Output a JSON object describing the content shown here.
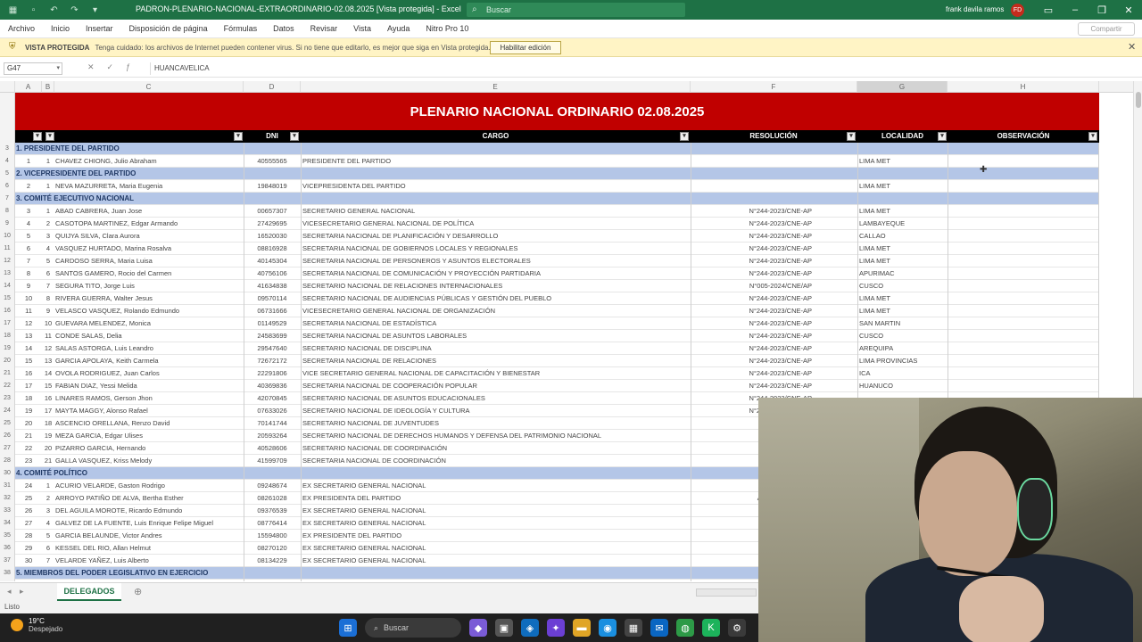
{
  "window": {
    "title": "PADRON-PLENARIO-NACIONAL-EXTRAORDINARIO-02.08.2025 [Vista protegida] - Excel",
    "search_placeholder": "Buscar",
    "user_name": "frank davila ramos",
    "user_initials": "FD"
  },
  "menu": [
    "Archivo",
    "Inicio",
    "Insertar",
    "Disposición de página",
    "Fórmulas",
    "Datos",
    "Revisar",
    "Vista",
    "Ayuda",
    "Nitro Pro 10"
  ],
  "share_label": "Compartir",
  "protected_view": {
    "label": "VISTA PROTEGIDA",
    "message": "Tenga cuidado: los archivos de Internet pueden contener virus. Si no tiene que editarlo, es mejor que siga en Vista protegida.",
    "button": "Habilitar edición"
  },
  "formula_bar": {
    "cell_ref": "G47",
    "formula": "HUANCAVELICA"
  },
  "columns": [
    "A",
    "B",
    "C",
    "D",
    "E",
    "F",
    "G",
    "H"
  ],
  "sheet": {
    "banner_title": "PLENARIO NACIONAL ORDINARIO 02.08.2025",
    "headers": {
      "dni": "DNI",
      "cargo": "CARGO",
      "resolucion": "RESOLUCIÓN",
      "localidad": "LOCALIDAD",
      "observacion": "OBSERVACIÓN"
    },
    "rows": [
      {
        "n": "3",
        "section": "1. PRESIDENTE DEL PARTIDO"
      },
      {
        "n": "4",
        "a": "1",
        "b": "1",
        "name": "CHAVEZ CHIONG, Julio Abraham",
        "dni": "40555565",
        "cargo": "PRESIDENTE DEL PARTIDO",
        "res": "",
        "loc": "LIMA MET"
      },
      {
        "n": "5",
        "section": "2. VICEPRESIDENTE DEL PARTIDO"
      },
      {
        "n": "6",
        "a": "2",
        "b": "1",
        "name": "NEVA MAZURRETA, Maria Eugenia",
        "dni": "19848019",
        "cargo": "VICEPRESIDENTA DEL PARTIDO",
        "res": "",
        "loc": "LIMA MET"
      },
      {
        "n": "7",
        "section": "3. COMITÉ EJECUTIVO NACIONAL"
      },
      {
        "n": "8",
        "a": "3",
        "b": "1",
        "name": "ABAD CABRERA, Juan Jose",
        "dni": "00657307",
        "cargo": "SECRETARIO GENERAL NACIONAL",
        "res": "N°244-2023/CNE-AP",
        "loc": "LIMA MET"
      },
      {
        "n": "9",
        "a": "4",
        "b": "2",
        "name": "CASOTOPA MARTINEZ, Edgar Armando",
        "dni": "27429695",
        "cargo": "VICESECRETARIO GENERAL NACIONAL DE POLÍTICA",
        "res": "N°244-2023/CNE-AP",
        "loc": "LAMBAYEQUE"
      },
      {
        "n": "10",
        "a": "5",
        "b": "3",
        "name": "QUIJYA SILVA, Clara Aurora",
        "dni": "16520030",
        "cargo": "SECRETARIA NACIONAL DE PLANIFICACIÓN Y DESARROLLO",
        "res": "N°244-2023/CNE-AP",
        "loc": "CALLAO"
      },
      {
        "n": "11",
        "a": "6",
        "b": "4",
        "name": "VASQUEZ HURTADO, Marina Rosalva",
        "dni": "08816928",
        "cargo": "SECRETARIA NACIONAL DE GOBIERNOS LOCALES Y REGIONALES",
        "res": "N°244-2023/CNE-AP",
        "loc": "LIMA MET"
      },
      {
        "n": "12",
        "a": "7",
        "b": "5",
        "name": "CARDOSO SERRA, Maria Luisa",
        "dni": "40145304",
        "cargo": "SECRETARIA NACIONAL DE PERSONEROS Y ASUNTOS ELECTORALES",
        "res": "N°244-2023/CNE-AP",
        "loc": "LIMA MET"
      },
      {
        "n": "13",
        "a": "8",
        "b": "6",
        "name": "SANTOS GAMERO, Rocio del Carmen",
        "dni": "40756106",
        "cargo": "SECRETARIA NACIONAL DE COMUNICACIÓN Y PROYECCIÓN PARTIDARIA",
        "res": "N°244-2023/CNE-AP",
        "loc": "APURIMAC"
      },
      {
        "n": "14",
        "a": "9",
        "b": "7",
        "name": "SEGURA TITO, Jorge Luis",
        "dni": "41634838",
        "cargo": "SECRETARIO NACIONAL DE RELACIONES INTERNACIONALES",
        "res": "N°005-2024/CNE/AP",
        "loc": "CUSCO"
      },
      {
        "n": "15",
        "a": "10",
        "b": "8",
        "name": "RIVERA GUERRA, Walter Jesus",
        "dni": "09570114",
        "cargo": "SECRETARIO NACIONAL DE AUDIENCIAS PÚBLICAS Y GESTIÓN DEL PUEBLO",
        "res": "N°244-2023/CNE-AP",
        "loc": "LIMA MET"
      },
      {
        "n": "16",
        "a": "11",
        "b": "9",
        "name": "VELASCO VASQUEZ, Rolando Edmundo",
        "dni": "06731666",
        "cargo": "VICESECRETARIO GENERAL NACIONAL DE ORGANIZACIÓN",
        "res": "N°244-2023/CNE-AP",
        "loc": "LIMA MET"
      },
      {
        "n": "17",
        "a": "12",
        "b": "10",
        "name": "GUEVARA MELENDEZ, Monica",
        "dni": "01149529",
        "cargo": "SECRETARIA NACIONAL DE ESTADÍSTICA",
        "res": "N°244-2023/CNE-AP",
        "loc": "SAN MARTIN"
      },
      {
        "n": "18",
        "a": "13",
        "b": "11",
        "name": "CONDE SALAS, Delia",
        "dni": "24583699",
        "cargo": "SECRETARIA NACIONAL DE ASUNTOS LABORALES",
        "res": "N°244-2023/CNE-AP",
        "loc": "CUSCO"
      },
      {
        "n": "19",
        "a": "14",
        "b": "12",
        "name": "SALAS ASTORGA, Luis Leandro",
        "dni": "29547640",
        "cargo": "SECRETARIO NACIONAL DE DISCIPLINA",
        "res": "N°244-2023/CNE-AP",
        "loc": "AREQUIPA"
      },
      {
        "n": "20",
        "a": "15",
        "b": "13",
        "name": "GARCIA APOLAYA, Keith Carmela",
        "dni": "72672172",
        "cargo": "SECRETARIA NACIONAL DE RELACIONES",
        "res": "N°244-2023/CNE-AP",
        "loc": "LIMA PROVINCIAS"
      },
      {
        "n": "21",
        "a": "16",
        "b": "14",
        "name": "OVOLA RODRIGUEZ, Juan Carlos",
        "dni": "22291806",
        "cargo": "VICE SECRETARIO GENERAL NACIONAL DE CAPACITACIÓN Y BIENESTAR",
        "res": "N°244-2023/CNE-AP",
        "loc": "ICA"
      },
      {
        "n": "22",
        "a": "17",
        "b": "15",
        "name": "FABIAN DIAZ, Yessi Melida",
        "dni": "40369836",
        "cargo": "SECRETARIA NACIONAL DE COOPERACIÓN POPULAR",
        "res": "N°244-2023/CNE-AP",
        "loc": "HUANUCO"
      },
      {
        "n": "23",
        "a": "18",
        "b": "16",
        "name": "LINARES RAMOS, Gerson Jhon",
        "dni": "42070845",
        "cargo": "SECRETARIO NACIONAL DE ASUNTOS EDUCACIONALES",
        "res": "N°244-2023/CNE-AP",
        "loc": ""
      },
      {
        "n": "24",
        "a": "19",
        "b": "17",
        "name": "MAYTA MAGGY, Alonso Rafael",
        "dni": "07633026",
        "cargo": "SECRETARIO NACIONAL DE IDEOLOGÍA Y CULTURA",
        "res": "N°244-2023/CNE-AP",
        "loc": ""
      },
      {
        "n": "25",
        "a": "20",
        "b": "18",
        "name": "ASCENCIO ORELLANA, Renzo David",
        "dni": "70141744",
        "cargo": "SECRETARIO NACIONAL DE JUVENTUDES",
        "res": "N°2",
        "loc": ""
      },
      {
        "n": "26",
        "a": "21",
        "b": "19",
        "name": "MEZA GARCIA, Edgar Ulises",
        "dni": "20593264",
        "cargo": "SECRETARIO NACIONAL DE DERECHOS HUMANOS Y DEFENSA DEL PATRIMONIO NACIONAL",
        "res": "N°2",
        "loc": ""
      },
      {
        "n": "27",
        "a": "22",
        "b": "20",
        "name": "PIZARRO GARCIA, Hernando",
        "dni": "40528606",
        "cargo": "SECRETARIO NACIONAL DE COORDINACIÓN",
        "res": "N°2",
        "loc": ""
      },
      {
        "n": "28",
        "a": "23",
        "b": "21",
        "name": "GALLA VASQUEZ, Kriss Melody",
        "dni": "41599709",
        "cargo": "SECRETARIA NACIONAL DE COORDINACIÓN",
        "res": "N°2",
        "loc": ""
      },
      {
        "n": "30",
        "section": "4. COMITÉ POLÍTICO"
      },
      {
        "n": "31",
        "a": "24",
        "b": "1",
        "name": "ACURIO VELARDE, Gaston Rodrigo",
        "dni": "09248674",
        "cargo": "EX SECRETARIO GENERAL NACIONAL",
        "res": "",
        "loc": ""
      },
      {
        "n": "32",
        "a": "25",
        "b": "2",
        "name": "ARROYO PATIÑO DE ALVA, Bertha Esther",
        "dni": "08261028",
        "cargo": "EX PRESIDENTA DEL PARTIDO",
        "res": "Acuerdo del Plena",
        "loc": ""
      },
      {
        "n": "33",
        "a": "26",
        "b": "3",
        "name": "DEL AGUILA MOROTE, Ricardo Edmundo",
        "dni": "09376539",
        "cargo": "EX SECRETARIO GENERAL NACIONAL",
        "res": "",
        "loc": ""
      },
      {
        "n": "34",
        "a": "27",
        "b": "4",
        "name": "GALVEZ DE LA FUENTE, Luis Enrique Felipe Miguel",
        "dni": "08776414",
        "cargo": "EX SECRETARIO GENERAL NACIONAL",
        "res": "",
        "loc": ""
      },
      {
        "n": "35",
        "a": "28",
        "b": "5",
        "name": "GARCIA BELAUNDE, Victor Andres",
        "dni": "15594800",
        "cargo": "EX PRESIDENTE DEL PARTIDO",
        "res": "",
        "loc": ""
      },
      {
        "n": "36",
        "a": "29",
        "b": "6",
        "name": "KESSEL DEL RIO, Allan Helmut",
        "dni": "08270120",
        "cargo": "EX SECRETARIO GENERAL NACIONAL",
        "res": "",
        "loc": ""
      },
      {
        "n": "37",
        "a": "30",
        "b": "7",
        "name": "VELARDE YAÑEZ, Luis Alberto",
        "dni": "08134229",
        "cargo": "EX SECRETARIO GENERAL NACIONAL",
        "res": "",
        "loc": ""
      },
      {
        "n": "38",
        "section": "5. MIEMBROS DEL PODER LEGISLATIVO EN EJERCICIO"
      }
    ]
  },
  "sheet_tab": "DELEGADOS",
  "status": "Listo",
  "taskbar": {
    "temperature": "19°C",
    "weather": "Despejado",
    "search": "Buscar"
  }
}
